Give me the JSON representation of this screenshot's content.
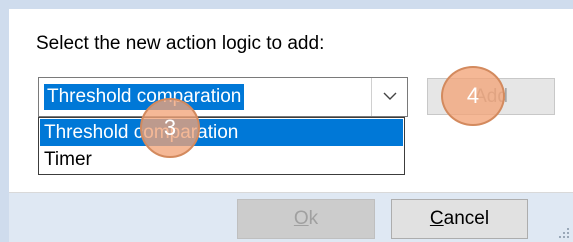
{
  "dialog": {
    "prompt": "Select the new action logic to add:",
    "combo": {
      "selected_value": "Threshold comparation",
      "icon": "chevron-down-icon"
    },
    "dropdown": {
      "options": [
        "Threshold comparation",
        "Timer"
      ],
      "highlighted_index": 0
    },
    "buttons": {
      "add_label": "Add",
      "add_enabled": false,
      "ok_label": "Ok",
      "ok_mnemonic": "O",
      "ok_rest": "k",
      "ok_enabled": false,
      "cancel_label": "Cancel",
      "cancel_mnemonic": "C",
      "cancel_rest": "ancel"
    }
  },
  "annotations": {
    "marker_3": "3",
    "marker_4": "4"
  },
  "colors": {
    "selection": "#0078d7",
    "marker_fill": "#f2a478",
    "window_frame": "#dfe8f3"
  }
}
